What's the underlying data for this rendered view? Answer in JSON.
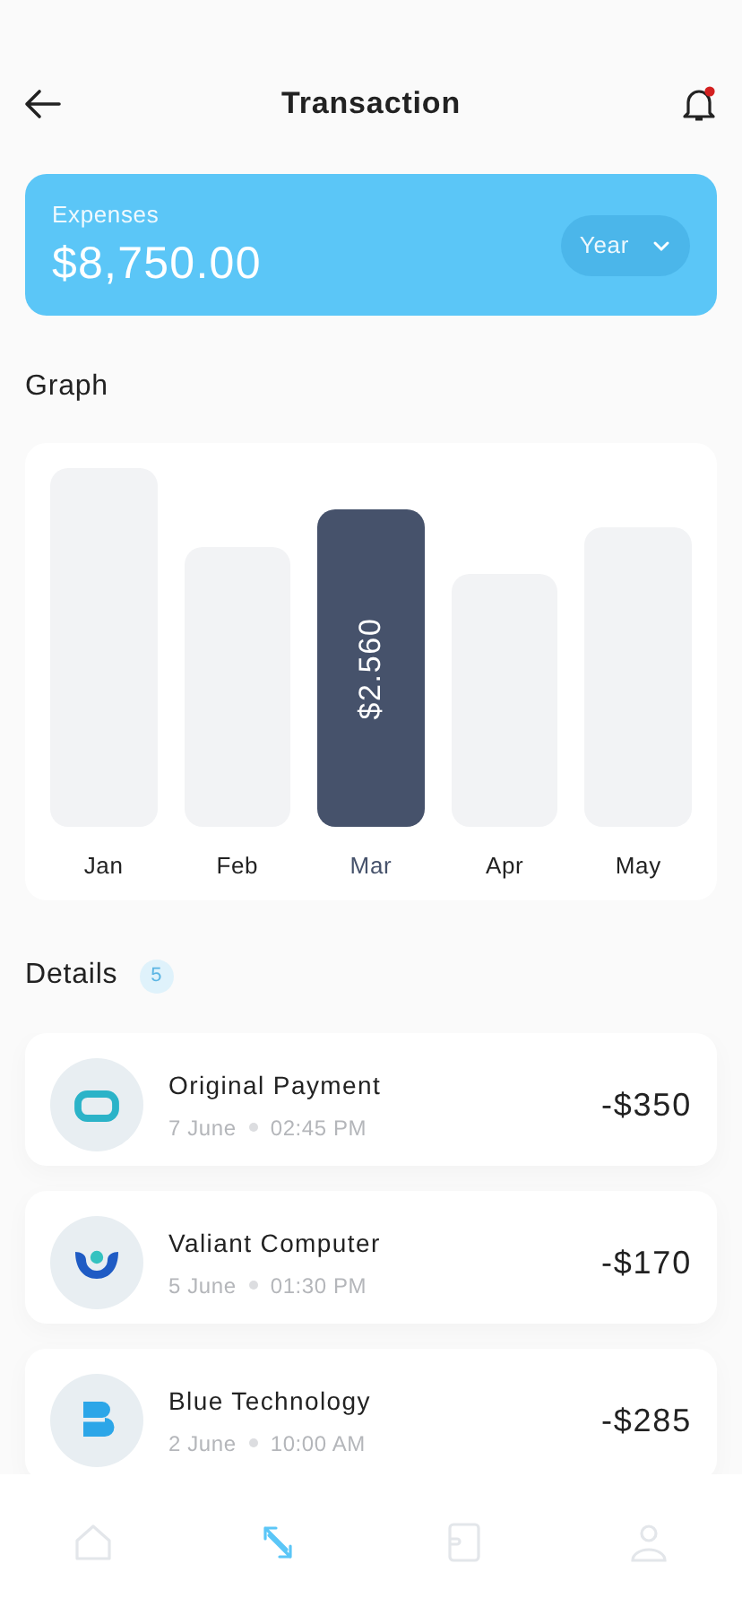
{
  "header": {
    "title": "Transaction",
    "notification": true
  },
  "summary": {
    "label": "Expenses",
    "amount": "$8,750.00",
    "period": "Year"
  },
  "graph": {
    "title": "Graph",
    "months": [
      {
        "label": "Jan",
        "selected": false
      },
      {
        "label": "Feb",
        "selected": false
      },
      {
        "label": "Mar",
        "selected": true,
        "value": "$2.560"
      },
      {
        "label": "Apr",
        "selected": false
      },
      {
        "label": "May",
        "selected": false
      }
    ]
  },
  "details": {
    "title": "Details",
    "count": "5",
    "transactions": [
      {
        "kind": "ring",
        "name": "Original Payment",
        "date": "7 June",
        "time": "02:45 PM",
        "amount": "-$350"
      },
      {
        "kind": "shield",
        "name": "Valiant Computer",
        "date": "5 June",
        "time": "01:30 PM",
        "amount": "-$170"
      },
      {
        "kind": "letter",
        "name": "Blue Technology",
        "date": "2 June",
        "time": "10:00 AM",
        "amount": "-$285"
      }
    ]
  },
  "nav": [
    {
      "kind": "home",
      "selected": false
    },
    {
      "kind": "transfer",
      "selected": true
    },
    {
      "kind": "wallet",
      "selected": false
    },
    {
      "kind": "profile",
      "selected": false
    }
  ]
}
